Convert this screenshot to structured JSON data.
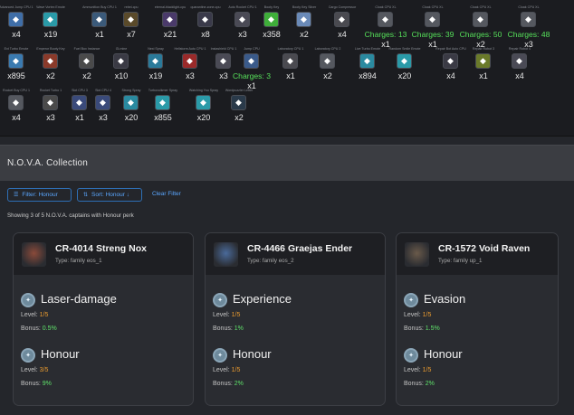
{
  "inventory": {
    "rows": [
      {
        "items": [
          {
            "name": "Advanced Jump CPU 1",
            "icon": "jump-cpu-icon",
            "qty": "x4",
            "bg": "#3f6ea8"
          },
          {
            "name": "Wave Vortex Emote",
            "icon": "skull-emote-icon",
            "qty": "x19",
            "bg": "#2a9aa8"
          },
          {
            "name": "Ammunition Buy CPU 1",
            "icon": "ammo-cpu-icon",
            "qty": "x1",
            "bg": "#3b5a7a"
          },
          {
            "name": "rebel-cpu",
            "icon": "rebel-cpu-icon",
            "qty": "x7",
            "bg": "#5a4a2a"
          },
          {
            "name": "eternal-blacklight-cpu",
            "icon": "blacklight-cpu-icon",
            "qty": "x21",
            "bg": "#4a3a6a"
          },
          {
            "name": "quarantine-zone-cpu",
            "icon": "quarantine-cpu-icon",
            "qty": "x8",
            "bg": "#3a3a4a"
          },
          {
            "name": "Auto Rocket CPU 1",
            "icon": "auto-rocket-cpu-icon",
            "qty": "x3",
            "bg": "#4a4a55"
          },
          {
            "name": "Booty Key",
            "icon": "booty-key-icon",
            "qty": "x358",
            "bg": "#3fae3a"
          },
          {
            "name": "Booty Key Silver",
            "icon": "silver-key-icon",
            "qty": "x2",
            "bg": "#6a8ab8"
          },
          {
            "name": "Cargo Compressor",
            "icon": "cargo-compressor-icon",
            "qty": "x4",
            "bg": "#4a4a50"
          },
          {
            "name": "Cloak CPU XL",
            "icon": "cloak-cpu-icon",
            "qty": "x1",
            "charges": "Charges: 13",
            "bg": "#55585f"
          },
          {
            "name": "Cloak CPU XL",
            "icon": "cloak-cpu-icon",
            "qty": "x1",
            "charges": "Charges: 39",
            "bg": "#55585f"
          },
          {
            "name": "Cloak CPU XL",
            "icon": "cloak-cpu-icon",
            "qty": "x2",
            "charges": "Charges: 50",
            "bg": "#55585f"
          },
          {
            "name": "Cloak CPU XL",
            "icon": "cloak-cpu-icon",
            "qty": "x3",
            "charges": "Charges: 48",
            "bg": "#55585f"
          }
        ]
      },
      {
        "items": [
          {
            "name": "Ext Turbo Emote",
            "icon": "turbo-emote-icon",
            "qty": "x895",
            "bg": "#3a7ab0"
          },
          {
            "name": "Emperor Booty Key",
            "icon": "emperor-key-icon",
            "qty": "x2",
            "bg": "#8a3a2a"
          },
          {
            "name": "Fuel Box Instance",
            "icon": "fuel-box-icon",
            "qty": "x2",
            "bg": "#4a4a4a"
          },
          {
            "name": "Gl-mine",
            "icon": "mine-icon",
            "qty": "x10",
            "bg": "#3a3a44"
          },
          {
            "name": "Nexi Spray",
            "icon": "nexi-spray-icon",
            "qty": "x19",
            "bg": "#2a7a9a"
          },
          {
            "name": "Hellstorm Auto CPU 1",
            "icon": "hellstorm-cpu-icon",
            "qty": "x3",
            "bg": "#9a2a2a"
          },
          {
            "name": "Instashield CPU 1",
            "icon": "instashield-cpu-icon",
            "qty": "x3",
            "bg": "#4a4a55"
          },
          {
            "name": "Jump CPU",
            "icon": "jump-cpu-icon",
            "qty": "x1",
            "charges": "Charges: 3",
            "bg": "#3a5a8a"
          },
          {
            "name": "Laboratory CPU 1",
            "icon": "lab-cpu-icon",
            "qty": "x1",
            "bg": "#4a4a50"
          },
          {
            "name": "Laboratory CPU 2",
            "icon": "lab-cpu-icon",
            "qty": "x2",
            "bg": "#55585f"
          },
          {
            "name": "Live Turbo Emote",
            "icon": "live-turbo-icon",
            "qty": "x894",
            "bg": "#2a8aa0"
          },
          {
            "name": "Random Smile Emote",
            "icon": "smile-emote-icon",
            "qty": "x20",
            "bg": "#2a9aa8"
          },
          {
            "name": "Repair Bot Auto CPU",
            "icon": "repair-bot-icon",
            "qty": "x4",
            "bg": "#3a3a44"
          },
          {
            "name": "Repair Robot 3",
            "icon": "repair-robot-icon",
            "qty": "x1",
            "bg": "#6a7a2a"
          },
          {
            "name": "Repair Robot 4",
            "icon": "repair-robot-icon",
            "qty": "x4",
            "bg": "#4a4a55"
          }
        ]
      },
      {
        "items": [
          {
            "name": "Rocket Buy CPU 1",
            "icon": "rocket-cpu-icon",
            "qty": "x4",
            "bg": "#55585f"
          },
          {
            "name": "Rocket Turbo 1",
            "icon": "rocket-turbo-icon",
            "qty": "x3",
            "bg": "#4a4a4a"
          },
          {
            "name": "Slot CPU 3",
            "icon": "slot-cpu-icon",
            "qty": "x1",
            "bg": "#3a4a7a"
          },
          {
            "name": "Slot CPU 4",
            "icon": "slot-cpu-icon",
            "qty": "x3",
            "bg": "#3a4a7a"
          },
          {
            "name": "Strong Spray",
            "icon": "strong-spray-icon",
            "qty": "x20",
            "bg": "#2a8aa0"
          },
          {
            "name": "Turbovolkmer Spray",
            "icon": "turbo-spray-icon",
            "qty": "x855",
            "bg": "#2a9aa8"
          },
          {
            "name": "Watching You Spray",
            "icon": "eye-spray-icon",
            "qty": "x20",
            "bg": "#2a9aa8"
          },
          {
            "name": "Wordpuzzler Letter",
            "icon": "letter-icon",
            "qty": "x2",
            "bg": "#2a3a4a"
          }
        ]
      }
    ]
  },
  "nova": {
    "title": "N.O.V.A. Collection",
    "filter_label": "Filter: Honour",
    "sort_label": "Sort: Honour ↓",
    "clear_label": "Clear Filter",
    "showing": "Showing 3 of 5 N.O.V.A. captains with Honour perk",
    "level_label": "Level:",
    "bonus_label": "Bonus:",
    "cards": [
      {
        "name": "CR-4014 Streng Nox",
        "type": "Type: family eos_1",
        "avatar_icon": "captain-avatar-icon",
        "perks": [
          {
            "name": "Laser-damage",
            "icon": "laser-damage-icon",
            "level": "1/5",
            "bonus": "0.5%"
          },
          {
            "name": "Honour",
            "icon": "honour-icon",
            "level": "3/5",
            "bonus": "9%"
          }
        ]
      },
      {
        "name": "CR-4466 Graejas Ender",
        "type": "Type: family eos_2",
        "avatar_icon": "captain-avatar-icon",
        "perks": [
          {
            "name": "Experience",
            "icon": "experience-icon",
            "level": "1/5",
            "bonus": "1%"
          },
          {
            "name": "Honour",
            "icon": "honour-icon",
            "level": "1/5",
            "bonus": "2%"
          }
        ]
      },
      {
        "name": "CR-1572 Void Raven",
        "type": "Type: family up_1",
        "avatar_icon": "captain-avatar-icon",
        "perks": [
          {
            "name": "Evasion",
            "icon": "evasion-icon",
            "level": "1/5",
            "bonus": "1.5%"
          },
          {
            "name": "Honour",
            "icon": "honour-icon",
            "level": "1/5",
            "bonus": "2%"
          }
        ]
      }
    ]
  }
}
